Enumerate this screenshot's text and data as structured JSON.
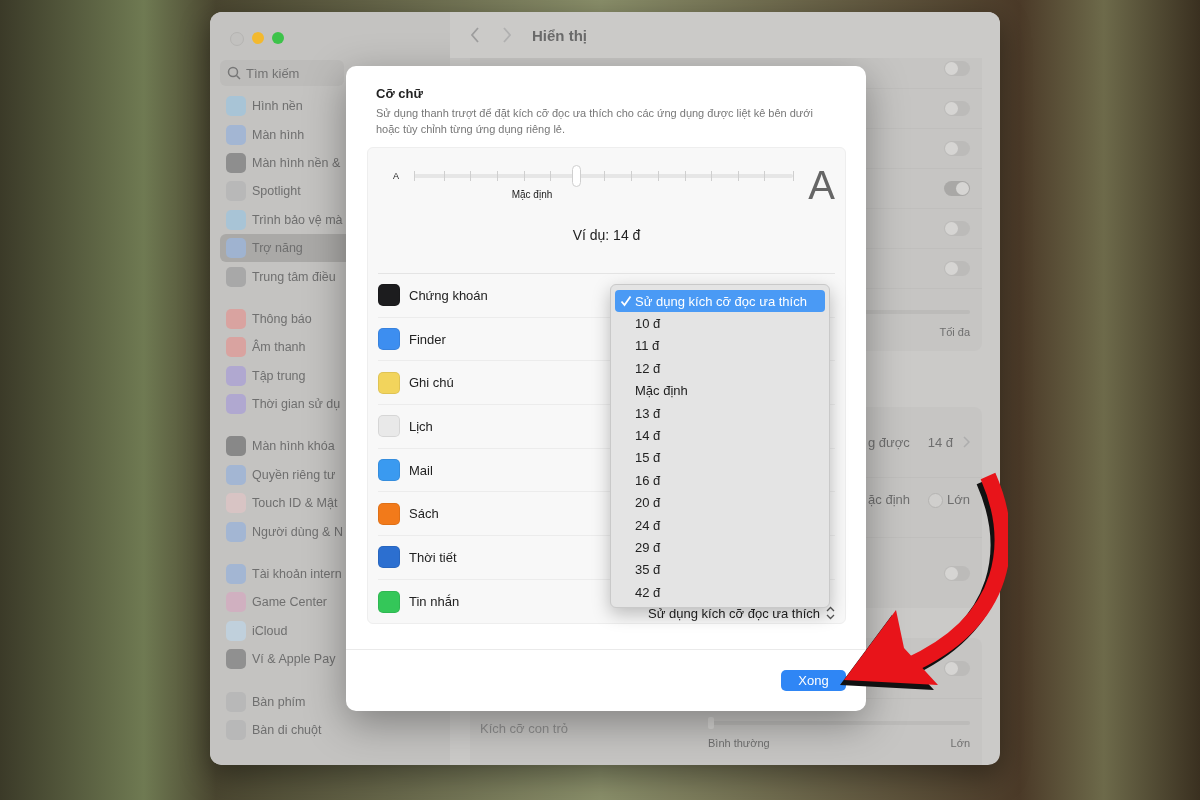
{
  "window": {
    "title": "Hiển thị",
    "sidebar": {
      "search_placeholder": "Tìm kiếm",
      "groups": [
        {
          "items": [
            {
              "label": "Hình nền",
              "color": "#a8c4d6",
              "selected": false
            },
            {
              "label": "Màn hình",
              "color": "#a3b6d3",
              "selected": false
            },
            {
              "label": "Màn hình nền &",
              "color": "#8e8e8e",
              "selected": false
            },
            {
              "label": "Spotlight",
              "color": "#b8b8b8",
              "selected": false
            },
            {
              "label": "Trình bảo vệ mà",
              "color": "#a8c4d6",
              "selected": false
            },
            {
              "label": "Trợ năng",
              "color": "#9fb3d0",
              "selected": true
            },
            {
              "label": "Trung tâm điều",
              "color": "#a8a8a8",
              "selected": false
            }
          ]
        },
        {
          "items": [
            {
              "label": "Thông báo",
              "color": "#d9a3a0",
              "selected": false
            },
            {
              "label": "Âm thanh",
              "color": "#d9a3a0",
              "selected": false
            },
            {
              "label": "Tập trung",
              "color": "#b0a8d0",
              "selected": false
            },
            {
              "label": "Thời gian sử dụ",
              "color": "#b0a8d0",
              "selected": false
            }
          ]
        },
        {
          "items": [
            {
              "label": "Màn hình khóa",
              "color": "#888888",
              "selected": false
            },
            {
              "label": "Quyền riêng tư",
              "color": "#a3b6d3",
              "selected": false
            },
            {
              "label": "Touch ID & Mật",
              "color": "#d8c4c4",
              "selected": false
            },
            {
              "label": "Người dùng & N",
              "color": "#a3b6d3",
              "selected": false
            }
          ]
        },
        {
          "items": [
            {
              "label": "Tài khoản intern",
              "color": "#a3b6d3",
              "selected": false
            },
            {
              "label": "Game Center",
              "color": "#d0b0c0",
              "selected": false
            },
            {
              "label": "iCloud",
              "color": "#c0d0dc",
              "selected": false
            },
            {
              "label": "Ví & Apple Pay",
              "color": "#909090",
              "selected": false
            }
          ]
        },
        {
          "items": [
            {
              "label": "Bàn phím",
              "color": "#b8b8b8",
              "selected": false
            },
            {
              "label": "Bàn di chuột",
              "color": "#b8b8b8",
              "selected": false
            }
          ]
        }
      ]
    },
    "content": {
      "groups": [
        {
          "rows": [
            {
              "kind": "toggle",
              "on": false
            },
            {
              "kind": "toggle",
              "on": false
            },
            {
              "kind": "toggle",
              "on": false
            },
            {
              "kind": "toggle",
              "on": true
            },
            {
              "kind": "toggle",
              "on": false
            },
            {
              "kind": "toggle",
              "on": false
            },
            {
              "kind": "slider",
              "max_label": "Tối đa"
            }
          ]
        },
        {
          "rows": [
            {
              "kind": "value",
              "label": "g được",
              "value": "14 đ"
            },
            {
              "kind": "radio",
              "label": "ặc định",
              "choice": {
                "label": "Lớn",
                "selected": false
              }
            },
            {
              "kind": "toggle",
              "on": false
            }
          ]
        },
        {
          "rows": [
            {
              "kind": "toggle",
              "on": false
            },
            {
              "kind": "slider",
              "label": "Kích cỡ con trỏ",
              "min_label": "Bình thường",
              "max_label": "Lớn",
              "level": 0
            }
          ]
        }
      ]
    }
  },
  "dialog": {
    "title": "Cỡ chữ",
    "description": "Sử dụng thanh trượt để đặt kích cỡ đọc ưa thích cho các ứng dụng được liệt kê bên dưới hoặc tùy chỉnh từng ứng dụng riêng lẻ.",
    "slider": {
      "min_label": "A",
      "max_label": "A",
      "default_label": "Mặc định",
      "level": 0.43
    },
    "example": "Ví dụ: 14 đ",
    "apps": [
      {
        "name": "Chứng khoán",
        "color": "#1c1c1e"
      },
      {
        "name": "Finder",
        "color": "#3d8ef0"
      },
      {
        "name": "Ghi chú",
        "color": "#f2d45c"
      },
      {
        "name": "Lịch",
        "color": "#e9e9e9"
      },
      {
        "name": "Mail",
        "color": "#3a9af0"
      },
      {
        "name": "Sách",
        "color": "#f27a1a"
      },
      {
        "name": "Thời tiết",
        "color": "#2c6fd0"
      },
      {
        "name": "Tin nhắn",
        "color": "#34c759",
        "popup": "Sử dụng kích cỡ đọc ưa thích"
      }
    ],
    "menu": [
      {
        "label": "Sử dụng kích cỡ đọc ưa thích",
        "selected": true
      },
      {
        "label": "10 đ",
        "selected": false
      },
      {
        "label": "11 đ",
        "selected": false
      },
      {
        "label": "12 đ",
        "selected": false
      },
      {
        "label": "Mặc định",
        "selected": false
      },
      {
        "label": "13 đ",
        "selected": false
      },
      {
        "label": "14 đ",
        "selected": false
      },
      {
        "label": "15 đ",
        "selected": false
      },
      {
        "label": "16 đ",
        "selected": false
      },
      {
        "label": "20 đ",
        "selected": false
      },
      {
        "label": "24 đ",
        "selected": false
      },
      {
        "label": "29 đ",
        "selected": false
      },
      {
        "label": "35 đ",
        "selected": false
      },
      {
        "label": "42 đ",
        "selected": false
      }
    ],
    "done_button": "Xong"
  }
}
